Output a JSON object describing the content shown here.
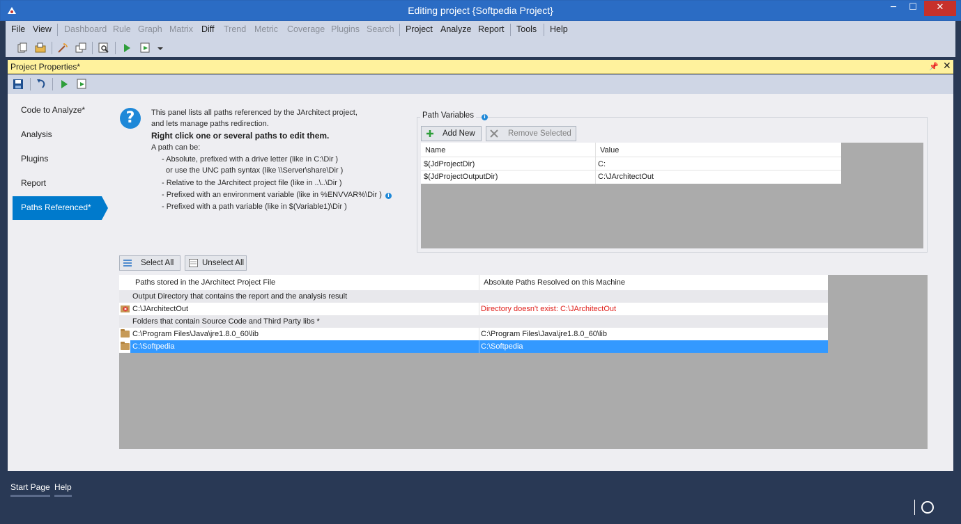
{
  "window": {
    "title": "Editing project {Softpedia Project}",
    "min": "─",
    "max": "☐",
    "close": "✕"
  },
  "menu": {
    "file": "File",
    "view": "View",
    "dashboard": "Dashboard",
    "rule": "Rule",
    "graph": "Graph",
    "matrix": "Matrix",
    "diff": "Diff",
    "trend": "Trend",
    "metric": "Metric",
    "coverage": "Coverage",
    "plugins": "Plugins",
    "search": "Search",
    "project": "Project",
    "analyze": "Analyze",
    "report": "Report",
    "tools": "Tools",
    "help": "Help"
  },
  "panel": {
    "title": "Project Properties*",
    "pin": "📌",
    "close": "✕"
  },
  "nav": {
    "code": "Code to Analyze*",
    "analysis": "Analysis",
    "plugins": "Plugins",
    "report": "Report",
    "paths": "Paths Referenced*"
  },
  "help": {
    "icon": "?",
    "line1": "This panel lists all paths referenced by the JArchitect project,",
    "line2": "and lets manage paths redirection.",
    "line3": "Right click one or several paths to edit them.",
    "line4": "A path can  be:",
    "line5": "- Absolute, prefixed with a drive letter (like in C:\\Dir )",
    "line6": "or use the UNC path syntax (like \\\\Server\\share\\Dir )",
    "line7": "- Relative to the JArchitect project file (like in ..\\..\\Dir )",
    "line8": "- Prefixed with an environment variable (like in %ENVVAR%\\Dir )",
    "line9": "- Prefixed with a path variable (like in $(Variable1)\\Dir )"
  },
  "pathvars": {
    "label": "Path Variables",
    "add": "Add New",
    "remove": "Remove Selected",
    "headers": {
      "name": "Name",
      "value": "Value"
    },
    "rows": [
      {
        "name": "$(JdProjectDir)",
        "value": "C:"
      },
      {
        "name": "$(JdProjectOutputDir)",
        "value": "C:\\JArchitectOut"
      }
    ]
  },
  "paths": {
    "select_all": "Select All",
    "unselect_all": "Unselect All",
    "headers": {
      "stored": "Paths stored in the JArchitect Project File",
      "resolved": "Absolute Paths Resolved on this Machine"
    },
    "group1": "Output Directory that contains the report and the analysis result",
    "row1": {
      "stored": "C:\\JArchitectOut",
      "resolved": "Directory doesn't exist: C:\\JArchitectOut"
    },
    "group2": "Folders that contain Source Code and Third Party libs *",
    "row2": {
      "stored": "C:\\Program Files\\Java\\jre1.8.0_60\\lib",
      "resolved": "C:\\Program Files\\Java\\jre1.8.0_60\\lib"
    },
    "row3": {
      "stored": "C:\\Softpedia",
      "resolved": "C:\\Softpedia"
    }
  },
  "bottom": {
    "start_page": "Start Page",
    "help": "Help"
  },
  "colors": {
    "accent": "#007acc",
    "title": "#2b6cc4",
    "selection": "#3399ff",
    "error": "#e0201b",
    "panel_header": "#fff29d"
  }
}
